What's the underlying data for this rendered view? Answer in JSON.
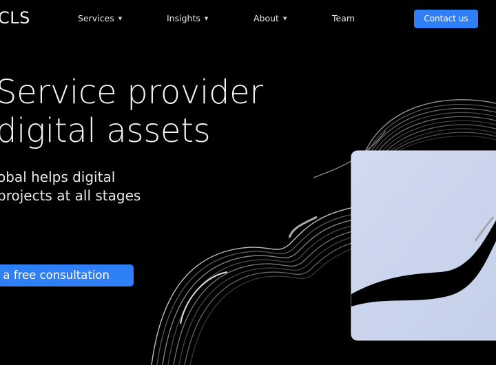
{
  "brand": {
    "logo_text": "CLS"
  },
  "nav": {
    "items": [
      {
        "label": "Services",
        "has_dropdown": true,
        "icon": "caret-down-icon"
      },
      {
        "label": "Insights",
        "has_dropdown": true,
        "icon": "caret-down-icon"
      },
      {
        "label": "About",
        "has_dropdown": true,
        "icon": "caret-down-icon"
      },
      {
        "label": "Team",
        "has_dropdown": false
      }
    ],
    "caret_glyph": "▼",
    "contact_label": "Contact us"
  },
  "hero": {
    "title_lines": [
      "Service provider",
      "digital assets"
    ],
    "subtitle_lines": [
      "obal helps digital",
      "projects at all stages"
    ],
    "cta_label": "a free consultation"
  },
  "colors": {
    "background": "#000000",
    "accent": "#2f80f7",
    "card": "#c9d4ec",
    "text": "#f4f4f4"
  },
  "illustration": {
    "description": "abstract silver ribbon wrapping a pale blue card",
    "icon": "ribbon-card-illustration"
  }
}
